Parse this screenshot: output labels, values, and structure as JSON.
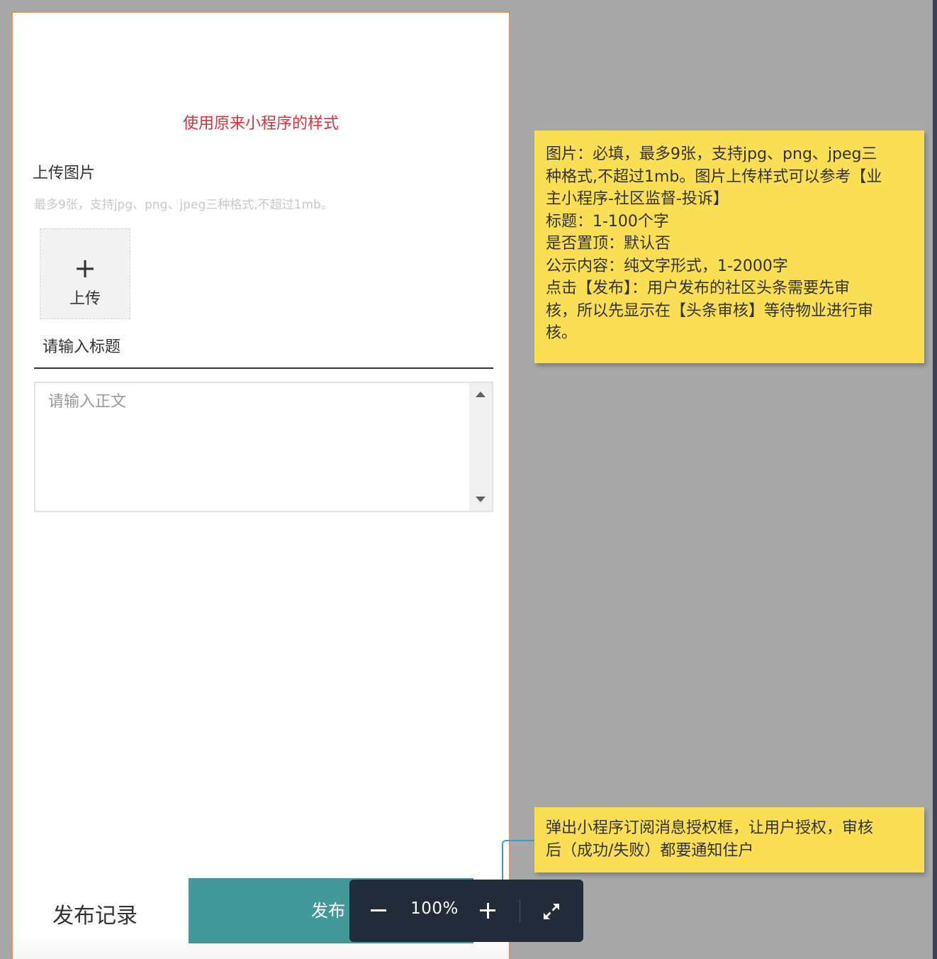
{
  "prototype": {
    "style_note": "使用原来小程序的样式",
    "upload": {
      "label": "上传图片",
      "hint": "最多9张，支持jpg、png、jpeg三种格式,不超过1mb。",
      "button_icon": "plus-icon",
      "button_label": "上传"
    },
    "title_input": {
      "placeholder": "请输入标题"
    },
    "body_input": {
      "placeholder": "请输入正文"
    },
    "footer": {
      "record_label": "发布记录",
      "publish_label": "发布"
    }
  },
  "notes": {
    "spec_lines": [
      "图片：必填，最多9张，支持jpg、png、jpeg三",
      "种格式,不超过1mb。图片上传样式可以参考【业",
      "主小程序-社区监督-投诉】",
      "标题：1-100个字",
      "是否置顶：默认否",
      "公示内容：纯文字形式，1-2000字",
      "点击【发布】：用户发布的社区头条需要先审",
      "核，所以先显示在【头条审核】等待物业进行审",
      "核。"
    ],
    "publish_lines": [
      "弹出小程序订阅消息授权框，让用户授权，审核",
      "后（成功/失败）都要通知住户"
    ]
  },
  "zoom": {
    "level": "100%",
    "out_icon": "minus-icon",
    "in_icon": "plus-icon",
    "fullscreen_icon": "expand-icon"
  },
  "colors": {
    "accent_red": "#d9323a",
    "publish_teal": "#43999a",
    "note_yellow": "#fadf54",
    "frame_orange": "#e3935a",
    "toolbar_bg": "#222b3a",
    "connector_blue": "#3f9acb"
  }
}
